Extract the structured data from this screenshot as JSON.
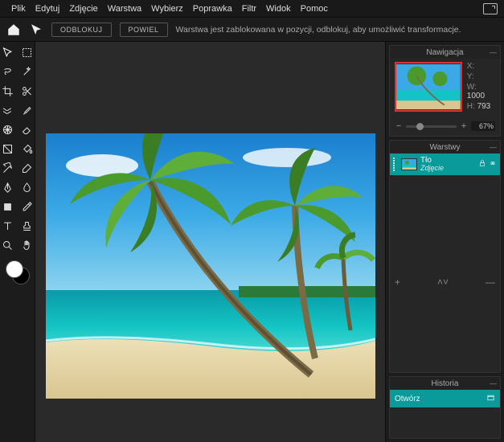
{
  "menu": {
    "items": [
      "Plik",
      "Edytuj",
      "Zdjęcie",
      "Warstwa",
      "Wybierz",
      "Poprawka",
      "Filtr",
      "Widok",
      "Pomoc"
    ]
  },
  "optionsbar": {
    "button1": "ODBLOKUJ",
    "button2": "POWIEL",
    "info": "Warstwa jest zablokowana w pozycji, odblokuj, aby umożliwić transformacje."
  },
  "navigator": {
    "title": "Nawigacja",
    "x_label": "X:",
    "y_label": "Y:",
    "w_label": "W:",
    "h_label": "H:",
    "w_value": "1000",
    "h_value": "793",
    "zoom": "67%"
  },
  "layers": {
    "title": "Warstwy",
    "items": [
      {
        "name": "Tło",
        "type": "Zdjęcie"
      }
    ]
  },
  "history": {
    "title": "Historia",
    "items": [
      {
        "label": "Otwórz"
      }
    ]
  },
  "tools": [
    "move",
    "marquee",
    "lasso",
    "wand",
    "crop",
    "cut",
    "liquify",
    "brush",
    "globe",
    "eraser",
    "gradient",
    "fill",
    "clone",
    "dodge",
    "pen",
    "blur",
    "shape",
    "pick",
    "text",
    "clone2",
    "zoom",
    "hand"
  ]
}
